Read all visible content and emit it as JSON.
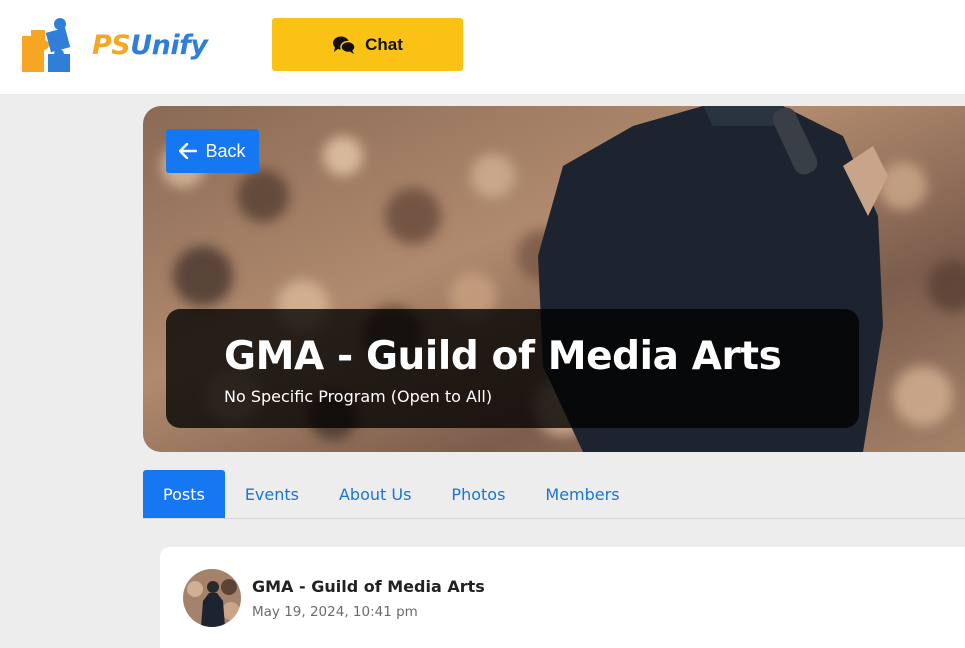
{
  "header": {
    "logo_text_ps": "PS",
    "logo_text_unify": "Unify",
    "logo_icon": "puzzle-icon",
    "chat_label": "Chat",
    "chat_icon": "chat-bubbles-icon"
  },
  "hero": {
    "back_label": "Back",
    "back_icon": "arrow-left-icon",
    "title": "GMA - Guild of Media Arts",
    "subtitle": "No Specific Program (Open to All)"
  },
  "tabs": [
    {
      "label": "Posts",
      "active": true
    },
    {
      "label": "Events",
      "active": false
    },
    {
      "label": "About Us",
      "active": false
    },
    {
      "label": "Photos",
      "active": false
    },
    {
      "label": "Members",
      "active": false
    }
  ],
  "post": {
    "author": "GMA - Guild of Media Arts",
    "date": "May 19, 2024, 10:41 pm"
  },
  "colors": {
    "accent_blue": "#1677f2",
    "chat_yellow": "#fbc216",
    "logo_orange": "#f6a623",
    "logo_blue": "#2f7fd8"
  }
}
